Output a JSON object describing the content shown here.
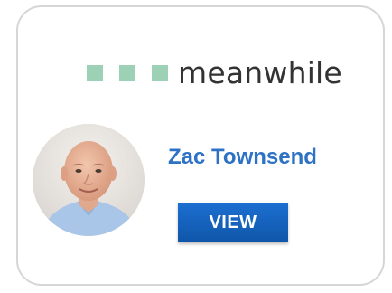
{
  "brand": {
    "name": "meanwhile",
    "square_color": "#9dd1b5",
    "text_color": "#333333"
  },
  "profile": {
    "name": "Zac Townsend",
    "name_color": "#2d72c4",
    "avatar_icon": "person-photo"
  },
  "actions": {
    "view_label": "VIEW",
    "view_color": "#1565c0"
  }
}
